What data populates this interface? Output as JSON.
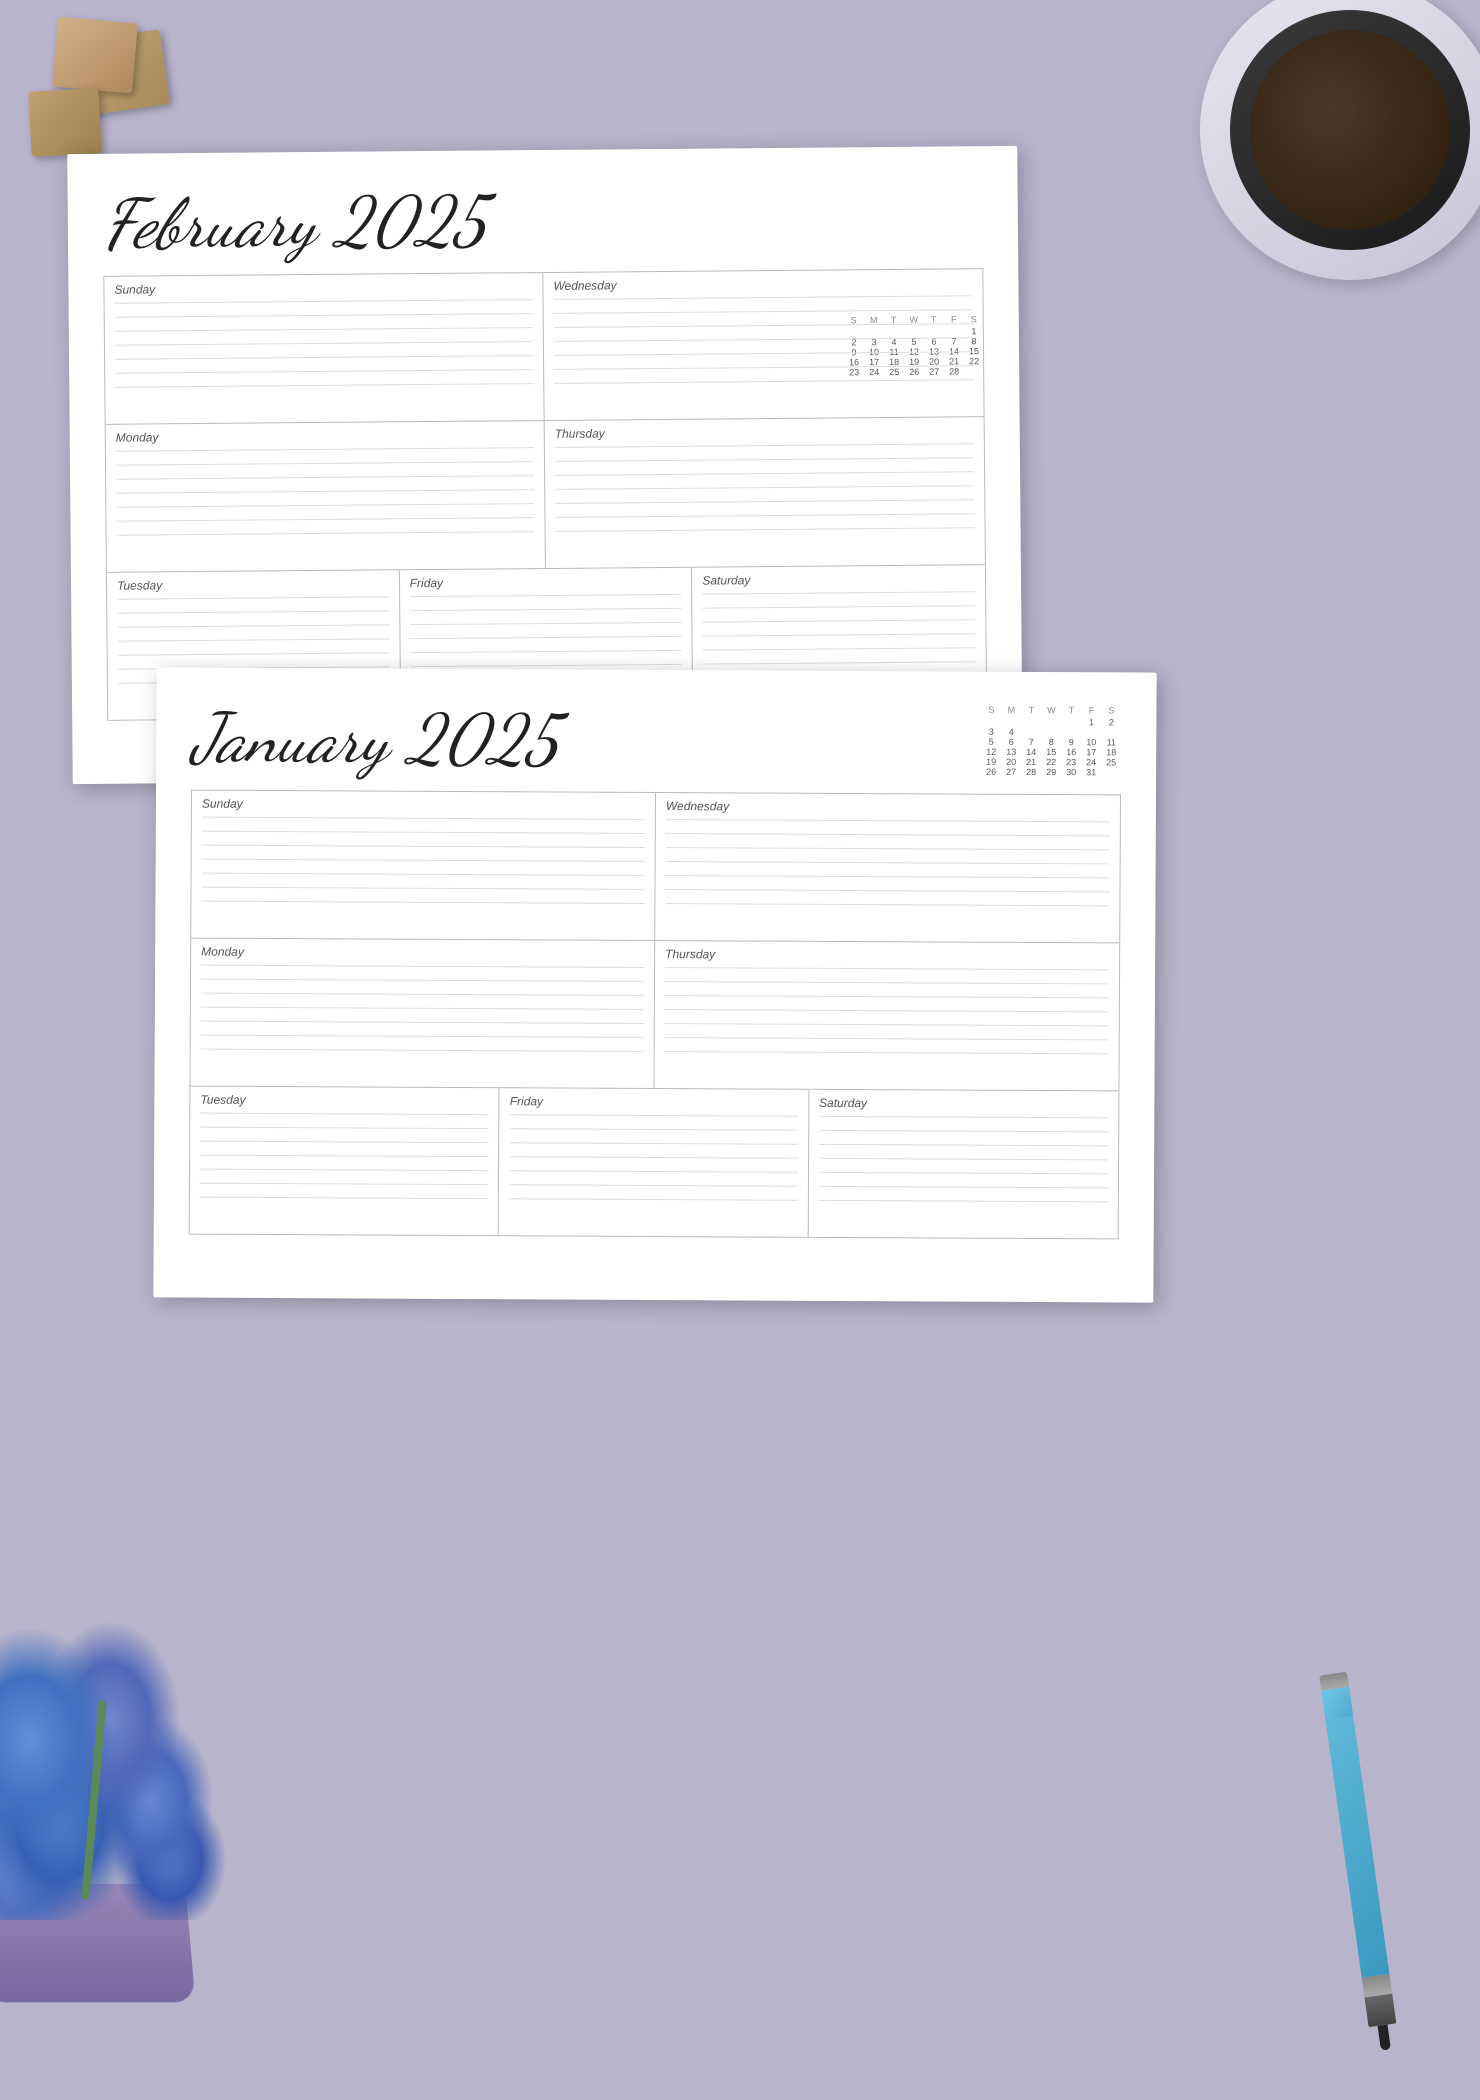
{
  "background": {
    "color": "#b8b4cc"
  },
  "february": {
    "title": "February 2025",
    "days": [
      "Sunday",
      "Monday",
      "Tuesday",
      "Wednesday",
      "Thursday",
      "Friday",
      "Saturday"
    ],
    "mini_calendar": {
      "headers": [
        "S",
        "M",
        "T",
        "W",
        "T",
        "F",
        "S"
      ],
      "rows": [
        [
          "",
          "",
          "",
          "",
          "",
          "",
          "1"
        ],
        [
          "2",
          "3",
          "4",
          "5",
          "6",
          "7",
          "8"
        ],
        [
          "9",
          "10",
          "11",
          "12",
          "13",
          "14",
          "15"
        ],
        [
          "16",
          "17",
          "18",
          "19",
          "20",
          "21",
          "22"
        ],
        [
          "23",
          "24",
          "25",
          "26",
          "27",
          "28",
          ""
        ]
      ]
    }
  },
  "january": {
    "title": "January 2025",
    "days": [
      "Sunday",
      "Monday",
      "Tuesday",
      "Wednesday",
      "Thursday",
      "Friday",
      "Saturday"
    ],
    "mini_calendar": {
      "headers": [
        "S",
        "M",
        "T",
        "W",
        "T",
        "F",
        "S"
      ],
      "rows": [
        [
          "",
          "",
          "1",
          "2",
          "3",
          "4"
        ],
        [
          "5",
          "6",
          "7",
          "8",
          "9",
          "10",
          "11"
        ],
        [
          "12",
          "13",
          "14",
          "15",
          "16",
          "17",
          "18"
        ],
        [
          "19",
          "20",
          "21",
          "22",
          "23",
          "24",
          "25"
        ],
        [
          "26",
          "27",
          "28",
          "29",
          "30",
          "31",
          ""
        ]
      ]
    }
  }
}
